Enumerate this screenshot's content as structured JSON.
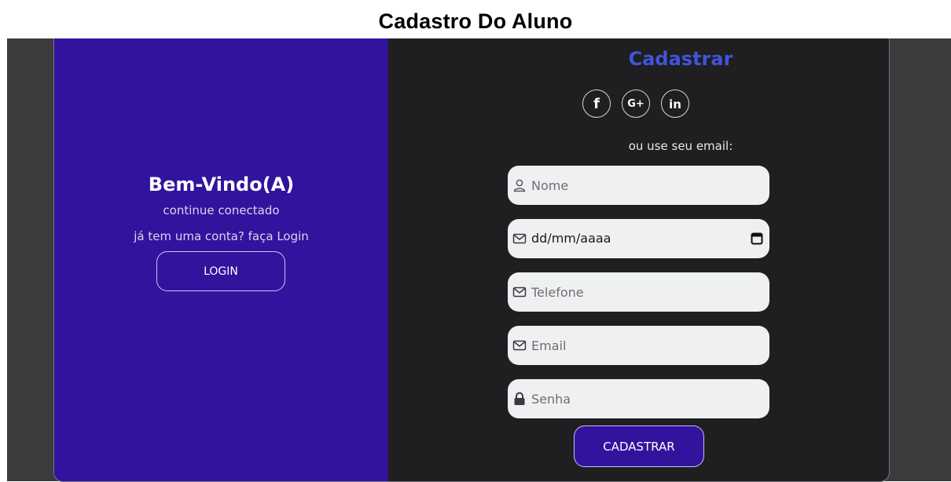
{
  "page": {
    "title": "Cadastro Do Aluno"
  },
  "welcome": {
    "title": "Bem-Vindo(A)",
    "subtitle": "continue conectado",
    "prompt": "já tem uma conta? faça Login",
    "login_label": "LOGIN"
  },
  "register": {
    "title": "Cadastrar",
    "social": [
      {
        "icon": "facebook-icon",
        "glyph": "f"
      },
      {
        "icon": "google-plus-icon",
        "glyph": "G+"
      },
      {
        "icon": "linkedin-icon",
        "glyph": "in"
      }
    ],
    "email_hint": "ou use seu email:",
    "fields": {
      "name": {
        "placeholder": "Nome",
        "icon": "user-icon"
      },
      "birthdate": {
        "value": "dd/mm/aaaa",
        "icon": "envelope-icon"
      },
      "phone": {
        "placeholder": "Telefone",
        "icon": "envelope-icon"
      },
      "email": {
        "placeholder": "Email",
        "icon": "envelope-icon"
      },
      "password": {
        "placeholder": "Senha",
        "icon": "lock-icon"
      }
    },
    "submit_label": "CADASTRAR"
  },
  "colors": {
    "brand_purple": "#32139e",
    "accent_blue": "#3f55d9",
    "panel_dark": "#1f1e21",
    "field_bg": "#eef0f1"
  }
}
